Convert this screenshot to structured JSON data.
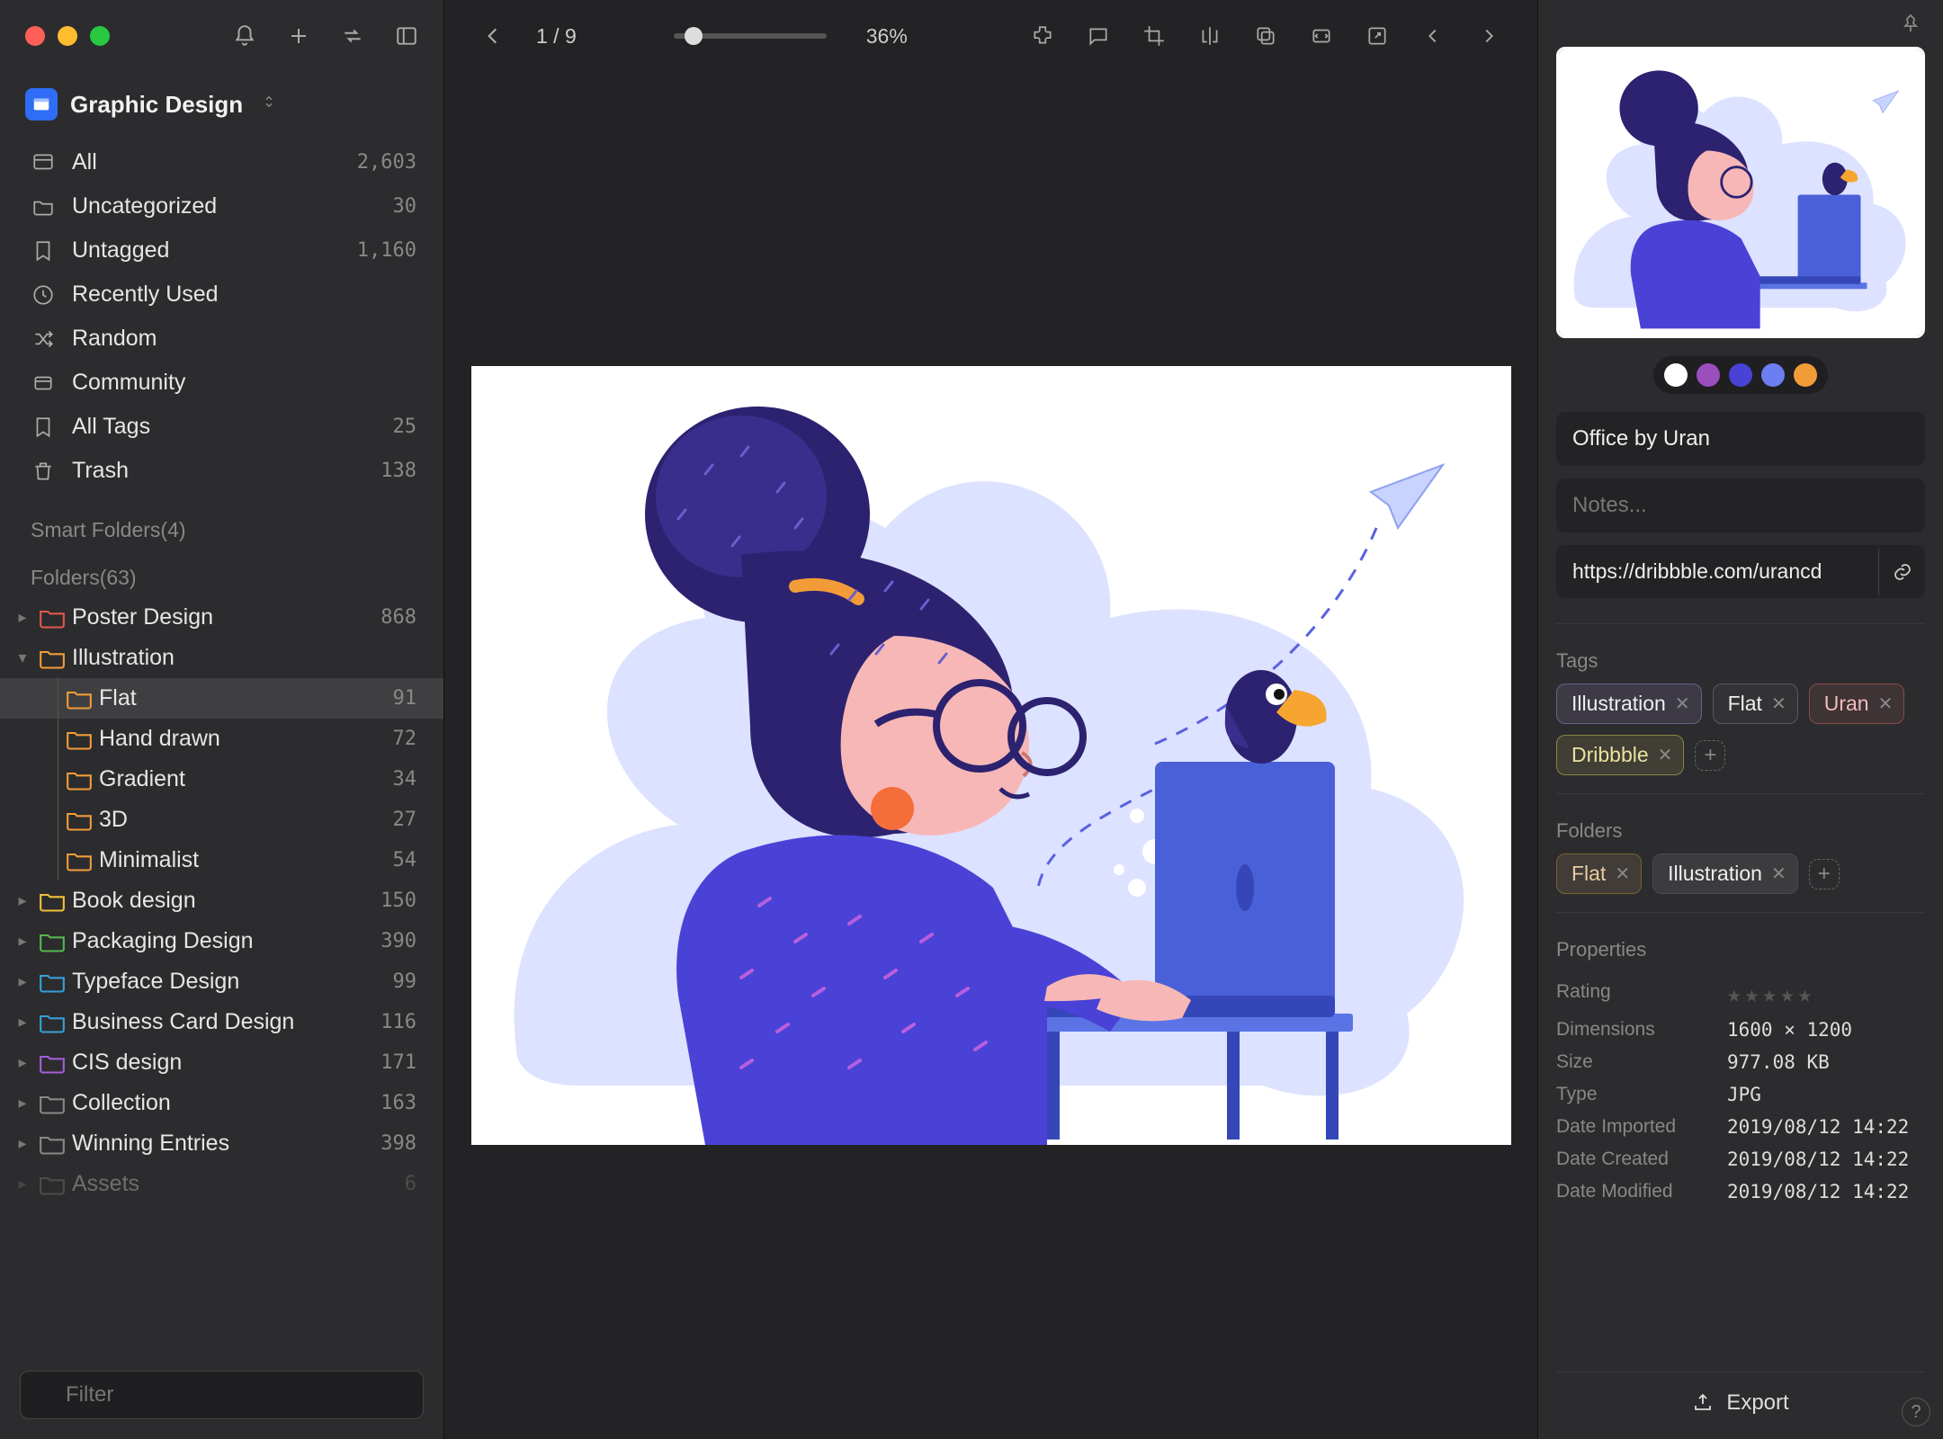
{
  "library": {
    "name": "Graphic Design"
  },
  "nav": [
    {
      "icon": "all",
      "label": "All",
      "count": "2,603"
    },
    {
      "icon": "uncategorized",
      "label": "Uncategorized",
      "count": "30"
    },
    {
      "icon": "untagged",
      "label": "Untagged",
      "count": "1,160"
    },
    {
      "icon": "recent",
      "label": "Recently Used",
      "count": ""
    },
    {
      "icon": "random",
      "label": "Random",
      "count": ""
    },
    {
      "icon": "community",
      "label": "Community",
      "count": ""
    },
    {
      "icon": "alltags",
      "label": "All Tags",
      "count": "25"
    },
    {
      "icon": "trash",
      "label": "Trash",
      "count": "138"
    }
  ],
  "smart_folders_heading": "Smart Folders(4)",
  "folders_heading": "Folders(63)",
  "folders": [
    {
      "label": "Poster Design",
      "count": "868",
      "color": "#e2574c",
      "expanded": false,
      "depth": 0
    },
    {
      "label": "Illustration",
      "count": "",
      "color": "#f29c38",
      "expanded": true,
      "depth": 0
    },
    {
      "label": "Flat",
      "count": "91",
      "color": "#f29c38",
      "depth": 1,
      "selected": true
    },
    {
      "label": "Hand drawn",
      "count": "72",
      "color": "#f29c38",
      "depth": 1
    },
    {
      "label": "Gradient",
      "count": "34",
      "color": "#f29c38",
      "depth": 1
    },
    {
      "label": "3D",
      "count": "27",
      "color": "#f29c38",
      "depth": 1
    },
    {
      "label": "Minimalist",
      "count": "54",
      "color": "#f29c38",
      "depth": 1
    },
    {
      "label": "Book design",
      "count": "150",
      "color": "#f2c13b",
      "depth": 0
    },
    {
      "label": "Packaging Design",
      "count": "390",
      "color": "#56b74e",
      "depth": 0
    },
    {
      "label": "Typeface Design",
      "count": "99",
      "color": "#36a0d9",
      "depth": 0
    },
    {
      "label": "Business Card Design",
      "count": "116",
      "color": "#36a0d9",
      "depth": 0
    },
    {
      "label": "CIS design",
      "count": "171",
      "color": "#a25fd9",
      "depth": 0
    },
    {
      "label": "Collection",
      "count": "163",
      "color": "#888888",
      "depth": 0
    },
    {
      "label": "Winning Entries",
      "count": "398",
      "color": "#888888",
      "depth": 0
    },
    {
      "label": "Assets",
      "count": "6",
      "color": "#888888",
      "depth": 0,
      "cutoff": true
    }
  ],
  "filter_placeholder": "Filter",
  "viewer": {
    "page_indicator": "1 / 9",
    "zoom_label": "36%"
  },
  "inspector": {
    "format_badge": "JPG",
    "swatches": [
      "#ffffff",
      "#9a4fbd",
      "#4a42d6",
      "#6c7ff2",
      "#f29c38"
    ],
    "title": "Office by Uran",
    "notes_placeholder": "Notes...",
    "url": "https://dribbble.com/urancd",
    "tags_heading": "Tags",
    "tags": [
      {
        "label": "Illustration",
        "variant": "t-illustration"
      },
      {
        "label": "Flat",
        "variant": "t-flat"
      },
      {
        "label": "Uran",
        "variant": "t-uran"
      },
      {
        "label": "Dribbble",
        "variant": "t-dribbble"
      }
    ],
    "folders_heading": "Folders",
    "folder_chips": [
      {
        "label": "Flat",
        "variant": "folder"
      },
      {
        "label": "Illustration",
        "variant": "gray"
      }
    ],
    "properties_heading": "Properties",
    "properties": [
      {
        "k": "Rating",
        "v": "★★★★★",
        "is_rating": true
      },
      {
        "k": "Dimensions",
        "v": "1600 × 1200"
      },
      {
        "k": "Size",
        "v": "977.08 KB"
      },
      {
        "k": "Type",
        "v": "JPG"
      },
      {
        "k": "Date Imported",
        "v": "2019/08/12 14:22"
      },
      {
        "k": "Date Created",
        "v": "2019/08/12 14:22"
      },
      {
        "k": "Date Modified",
        "v": "2019/08/12 14:22"
      }
    ],
    "export_label": "Export"
  }
}
